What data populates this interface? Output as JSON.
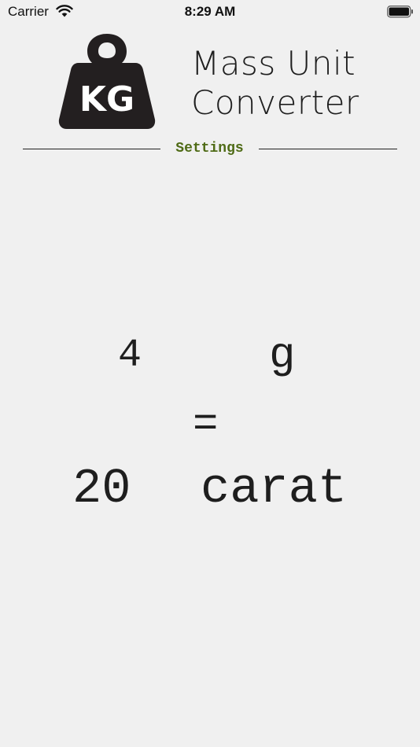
{
  "status_bar": {
    "carrier": "Carrier",
    "time": "8:29 AM",
    "wifi_icon": "wifi-icon",
    "battery_icon": "battery-icon"
  },
  "header": {
    "logo_text": "KG",
    "title_line1": "Mass Unit",
    "title_line2": "Converter",
    "settings_label": "Settings"
  },
  "converter": {
    "input_value": "4",
    "input_unit": "g",
    "equals": "=",
    "output_value": "20",
    "output_unit": "carat"
  },
  "colors": {
    "background": "#f0f0f0",
    "settings_accent": "#4f6b16",
    "logo": "#231f20"
  }
}
